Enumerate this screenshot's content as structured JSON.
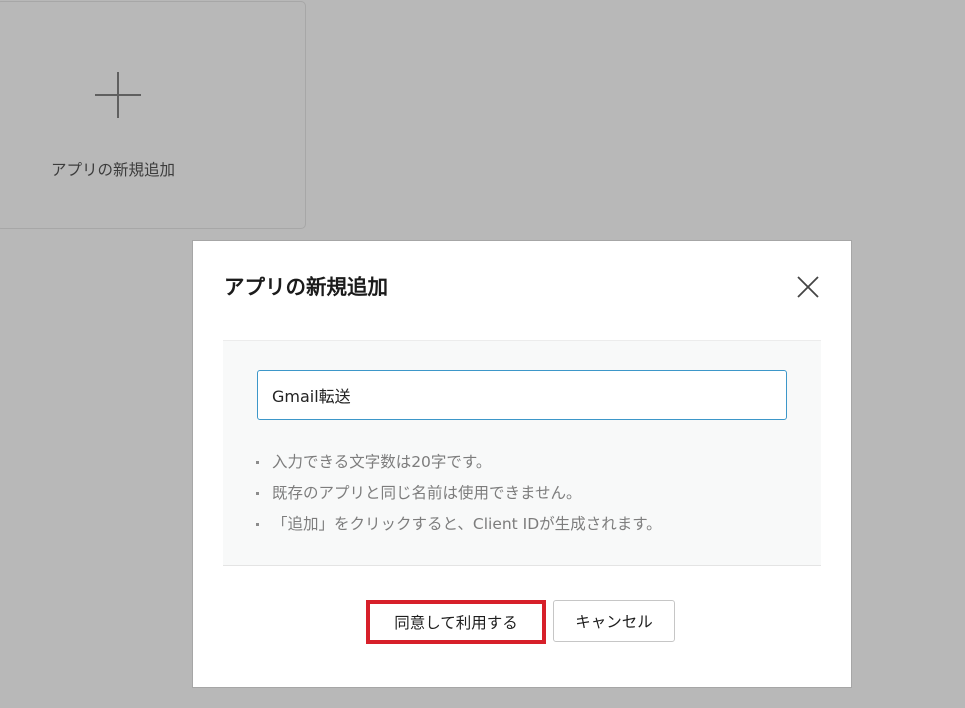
{
  "background_card": {
    "icon": "plus-icon",
    "label": "アプリの新規追加"
  },
  "dialog": {
    "title": "アプリの新規追加",
    "close_icon": "close-icon",
    "input_value": "Gmail転送",
    "notes": [
      "入力できる文字数は20字です。",
      "既存のアプリと同じ名前は使用できません。",
      "「追加」をクリックすると、Client IDが生成されます。"
    ],
    "agree_label": "同意して利用する",
    "cancel_label": "キャンセル"
  },
  "colors": {
    "overlay": "#b8b8b8",
    "dialog_bg": "#ffffff",
    "body_bg": "#f8f9f9",
    "input_border": "#3d97c9",
    "highlight": "#d7202a",
    "note_text": "#7d7d7d"
  }
}
